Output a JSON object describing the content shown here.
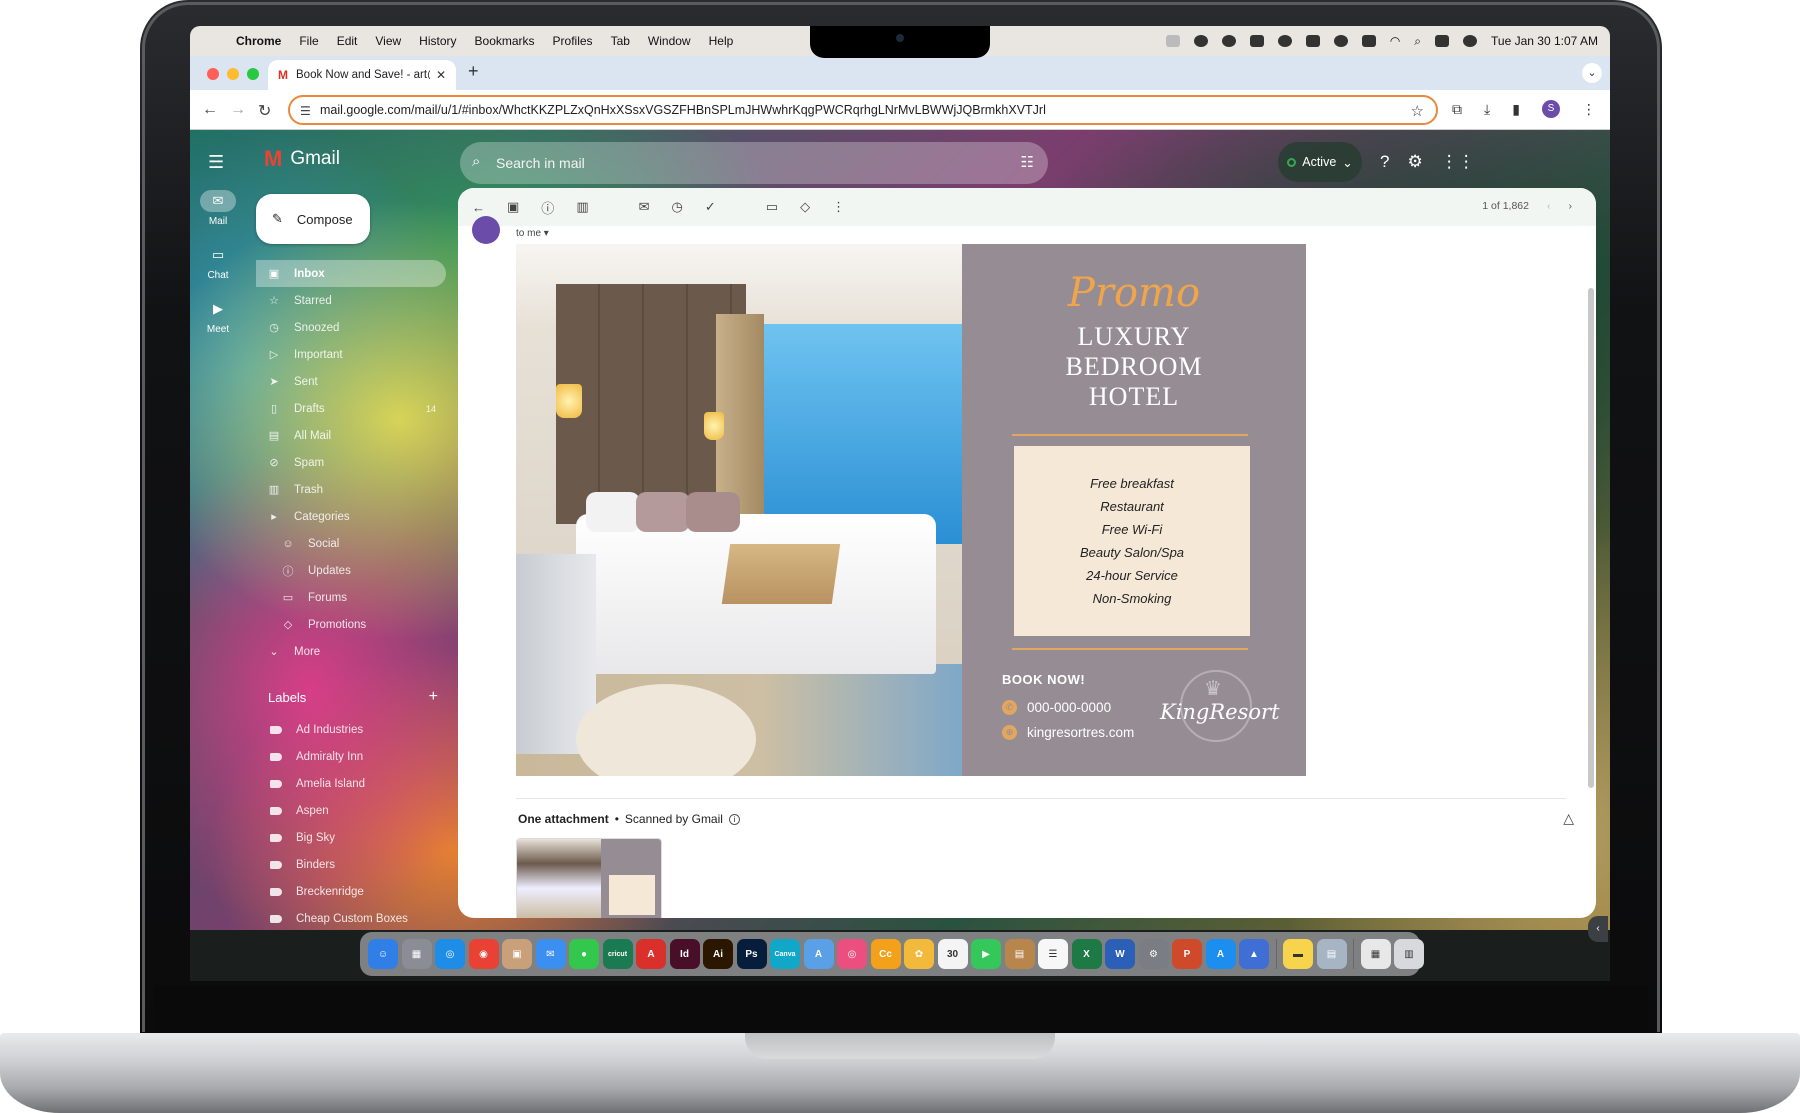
{
  "menubar": {
    "app": "Chrome",
    "items": [
      "File",
      "Edit",
      "View",
      "History",
      "Bookmarks",
      "Profiles",
      "Tab",
      "Window",
      "Help"
    ],
    "clock": "Tue Jan 30  1:07 AM"
  },
  "browser": {
    "tab_title": "Book Now and Save! - art@re",
    "url": "mail.google.com/mail/u/1/#inbox/WhctKKZPLZxQnHxXSsxVGSZFHBnSPLmJHWwhrKqgPWCRqrhgLNrMvLBWWjJQBrmkhXVTJrl",
    "profile_initial": "S"
  },
  "gmail": {
    "logo_text": "Gmail",
    "search_placeholder": "Search in mail",
    "status": "Active",
    "rail": [
      {
        "label": "Mail",
        "icon": "mail-icon",
        "glyph": "✉"
      },
      {
        "label": "Chat",
        "icon": "chat-icon",
        "glyph": "▭"
      },
      {
        "label": "Meet",
        "icon": "video-icon",
        "glyph": "▶"
      }
    ],
    "compose": "Compose",
    "nav": [
      {
        "label": "Inbox",
        "icon": "inbox-icon",
        "glyph": "▣",
        "count": ""
      },
      {
        "label": "Starred",
        "icon": "star-icon",
        "glyph": "☆",
        "count": ""
      },
      {
        "label": "Snoozed",
        "icon": "clock-icon",
        "glyph": "◷",
        "count": ""
      },
      {
        "label": "Important",
        "icon": "important-icon",
        "glyph": "▷",
        "count": ""
      },
      {
        "label": "Sent",
        "icon": "send-icon",
        "glyph": "➤",
        "count": ""
      },
      {
        "label": "Drafts",
        "icon": "draft-icon",
        "glyph": "▯",
        "count": "14"
      },
      {
        "label": "All Mail",
        "icon": "all-mail-icon",
        "glyph": "▤",
        "count": ""
      },
      {
        "label": "Spam",
        "icon": "spam-icon",
        "glyph": "⊘",
        "count": ""
      },
      {
        "label": "Trash",
        "icon": "trash-icon",
        "glyph": "▥",
        "count": ""
      },
      {
        "label": "Categories",
        "icon": "label-icon",
        "glyph": "▸",
        "count": ""
      },
      {
        "label": "Social",
        "icon": "people-icon",
        "glyph": "☺",
        "count": ""
      },
      {
        "label": "Updates",
        "icon": "info-icon",
        "glyph": "ⓘ",
        "count": ""
      },
      {
        "label": "Forums",
        "icon": "forum-icon",
        "glyph": "▭",
        "count": ""
      },
      {
        "label": "Promotions",
        "icon": "tag-icon",
        "glyph": "◇",
        "count": ""
      },
      {
        "label": "More",
        "icon": "chevron-down-icon",
        "glyph": "⌄",
        "count": ""
      }
    ],
    "labels_heading": "Labels",
    "labels": [
      "Ad Industries",
      "Admiralty Inn",
      "Amelia Island",
      "Aspen",
      "Big Sky",
      "Binders",
      "Breckenridge",
      "Cheap Custom Boxes"
    ],
    "pager": "1 of 1,862",
    "to_me": "to me"
  },
  "promo": {
    "script": "Promo",
    "title_lines": [
      "LUXURY",
      "BEDROOM",
      "HOTEL"
    ],
    "amenities": [
      "Free breakfast",
      "Restaurant",
      "Free Wi-Fi",
      "Beauty Salon/Spa",
      "24-hour Service",
      "Non-Smoking"
    ],
    "book_now": "BOOK NOW!",
    "phone": "000-000-0000",
    "website": "kingresortres.com",
    "brand": "KingResort"
  },
  "attachment": {
    "title": "One attachment",
    "scanned": "Scanned by Gmail"
  },
  "dock": [
    {
      "name": "finder",
      "color": "#2f7fe6",
      "text": "☺"
    },
    {
      "name": "launchpad",
      "color": "#8a8d96",
      "text": "▦"
    },
    {
      "name": "safari",
      "color": "#1e8de8",
      "text": "◎"
    },
    {
      "name": "chrome",
      "color": "#e94235",
      "text": "◉"
    },
    {
      "name": "preview",
      "color": "#c9a07a",
      "text": "▣"
    },
    {
      "name": "mail",
      "color": "#3b8ff0",
      "text": "✉"
    },
    {
      "name": "messages",
      "color": "#33c74e",
      "text": "●"
    },
    {
      "name": "cricut",
      "color": "#1a7a52",
      "text": "cricut"
    },
    {
      "name": "acrobat",
      "color": "#d9302c",
      "text": "A"
    },
    {
      "name": "indesign",
      "color": "#4a0f28",
      "text": "Id"
    },
    {
      "name": "illustrator",
      "color": "#2b1600",
      "text": "Ai"
    },
    {
      "name": "photoshop",
      "color": "#061e3b",
      "text": "Ps"
    },
    {
      "name": "canva",
      "color": "#11a7c8",
      "text": "Canva"
    },
    {
      "name": "maps",
      "color": "#5aa0e6",
      "text": "A"
    },
    {
      "name": "photobooth",
      "color": "#ea4f7f",
      "text": "◎"
    },
    {
      "name": "creative-cloud",
      "color": "#f3a01b",
      "text": "Cc"
    },
    {
      "name": "photos",
      "color": "#f2b93b",
      "text": "✿"
    },
    {
      "name": "calendar",
      "color": "#f4f4f4",
      "text": "30"
    },
    {
      "name": "facetime",
      "color": "#34c759",
      "text": "▶"
    },
    {
      "name": "contacts",
      "color": "#b8864d",
      "text": "▤"
    },
    {
      "name": "reminders",
      "color": "#f7f7f7",
      "text": "☰"
    },
    {
      "name": "excel",
      "color": "#1d7a45",
      "text": "X"
    },
    {
      "name": "word",
      "color": "#2b5fb8",
      "text": "W"
    },
    {
      "name": "system-settings",
      "color": "#7a7d84",
      "text": "⚙"
    },
    {
      "name": "powerpoint",
      "color": "#cf4a2a",
      "text": "P"
    },
    {
      "name": "app-store",
      "color": "#1b8ef0",
      "text": "A"
    },
    {
      "name": "screen-sharing",
      "color": "#3f6fd4",
      "text": "▲"
    },
    {
      "name": "notes",
      "color": "#f8d34c",
      "text": "▬"
    },
    {
      "name": "preview-doc",
      "color": "#a7b4c4",
      "text": "▤"
    },
    {
      "name": "downloads-stack",
      "color": "#e8e8e8",
      "text": "▦"
    },
    {
      "name": "trash",
      "color": "#d7d9dc",
      "text": "▥"
    }
  ]
}
